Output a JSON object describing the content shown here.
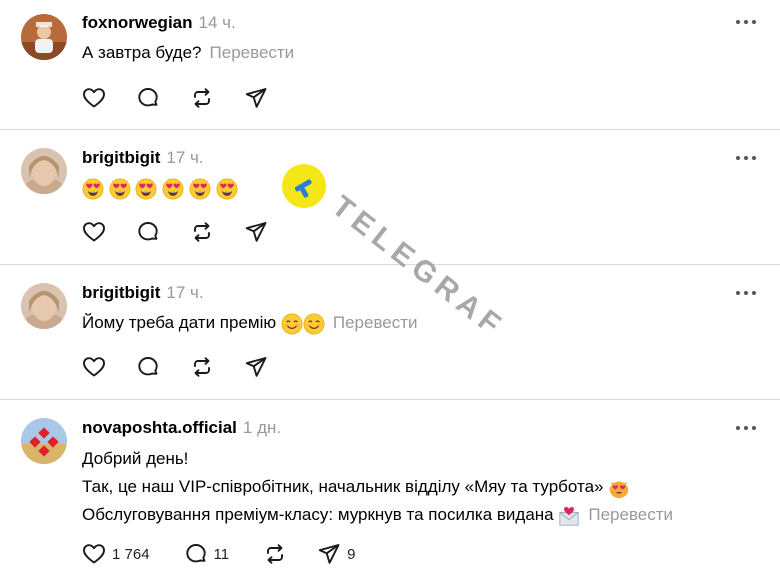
{
  "posts": [
    {
      "username": "foxnorwegian",
      "time": "14 ч.",
      "lines": [
        "А завтра буде?"
      ],
      "translate": "Перевести",
      "emojis": [],
      "counts": {
        "like": "",
        "reply": "",
        "repost": "",
        "share": ""
      }
    },
    {
      "username": "brigitbigit",
      "time": "17 ч.",
      "lines": [
        ""
      ],
      "translate": "",
      "emojis": [
        "heart-eyes",
        "heart-eyes",
        "heart-eyes",
        "heart-eyes",
        "heart-eyes",
        "heart-eyes"
      ],
      "counts": {
        "like": "",
        "reply": "",
        "repost": "",
        "share": ""
      }
    },
    {
      "username": "brigitbigit",
      "time": "17 ч.",
      "lines": [
        "Йому треба дати премію"
      ],
      "translate": "Перевести",
      "emojis": [
        "smiling-face",
        "smiling-face"
      ],
      "counts": {
        "like": "",
        "reply": "",
        "repost": "",
        "share": ""
      }
    },
    {
      "username": "novaposhta.official",
      "time": "1 дн.",
      "lines": [
        "Добрий день!",
        "Так, це наш VIP-співробітник, начальник відділу «Мяу та турбота»",
        "Обслуговування преміум-класу: муркнув та посилка видана"
      ],
      "translate": "Перевести",
      "emojis": [
        "heart-eyes-cat",
        "envelope-with-heart"
      ],
      "counts": {
        "like": "1 764",
        "reply": "11",
        "repost": "",
        "share": "9"
      }
    }
  ],
  "watermark": {
    "text": "TELEGRAF",
    "color": "#f5e616",
    "icon": "telegraf-logo"
  },
  "colors": {
    "text": "#000000",
    "muted": "#999999",
    "divider": "#dbdbdb",
    "icon": "#1a1a1a"
  }
}
